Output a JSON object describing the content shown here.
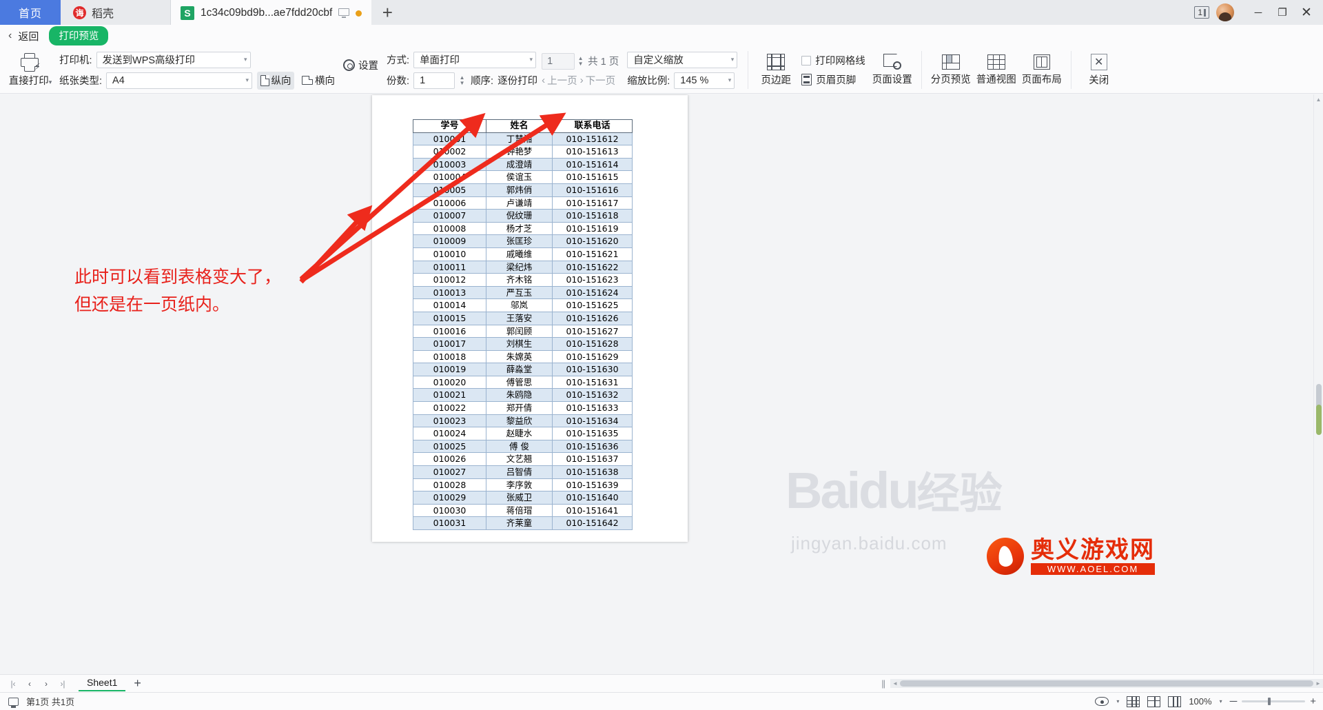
{
  "tabbar": {
    "home_label": "首页",
    "docer_label": "稻壳",
    "doc_label": "1c34c09bd9b...ae7fdd20cbf",
    "plus_label": "+",
    "window_count": "1",
    "minimize": "─",
    "restore": "❐",
    "close": "✕"
  },
  "preview_head": {
    "back_chevron": "‹",
    "back_label": "返回",
    "mode_pill": "打印预览"
  },
  "ribbon": {
    "direct_print_label": "直接打印",
    "direct_print_caret": "▾",
    "printer_label": "打印机:",
    "printer_value": "发送到WPS高级打印",
    "paper_label": "纸张类型:",
    "paper_value": "A4",
    "portrait_label": "纵向",
    "landscape_label": "横向",
    "settings_label": "设置",
    "mode_label": "方式:",
    "mode_value": "单面打印",
    "copies_label": "份数:",
    "copies_value": "1",
    "order_label": "顺序:",
    "order_value": "逐份打印",
    "page_current": "1",
    "page_total": "共 1 页",
    "prev_page": "上一页",
    "next_page": "下一页",
    "prev_chevron": "‹",
    "next_chevron": "›",
    "scale_mode_value": "自定义缩放",
    "scale_ratio_label": "缩放比例:",
    "scale_ratio_value": "145 %",
    "margin_label": "页边距",
    "gridlines_label": "打印网格线",
    "headerfooter_label": "页眉页脚",
    "pagesetup_label": "页面设置",
    "pagebreak_label": "分页预览",
    "normalview_label": "普通视图",
    "pagelayout_label": "页面布局",
    "close_label": "关闭",
    "caret": "▾"
  },
  "annotation": {
    "line1": "此时可以看到表格变大了，",
    "line2": "但还是在一页纸内。",
    "color": "#e8211b"
  },
  "document": {
    "headers": [
      "学号",
      "姓名",
      "联系电话"
    ],
    "rows": [
      [
        "010001",
        "丁慧湘",
        "010-151612"
      ],
      [
        "010002",
        "钟艳梦",
        "010-151613"
      ],
      [
        "010003",
        "成澄靖",
        "010-151614"
      ],
      [
        "010004",
        "侯谊玉",
        "010-151615"
      ],
      [
        "010005",
        "郭炜俏",
        "010-151616"
      ],
      [
        "010006",
        "卢谦靖",
        "010-151617"
      ],
      [
        "010007",
        "倪纹珊",
        "010-151618"
      ],
      [
        "010008",
        "杨才芝",
        "010-151619"
      ],
      [
        "010009",
        "张匡珍",
        "010-151620"
      ],
      [
        "010010",
        "戚曦维",
        "010-151621"
      ],
      [
        "010011",
        "梁纪炜",
        "010-151622"
      ],
      [
        "010012",
        "齐木铭",
        "010-151623"
      ],
      [
        "010013",
        "严互玉",
        "010-151624"
      ],
      [
        "010014",
        "邬岚",
        "010-151625"
      ],
      [
        "010015",
        "王落安",
        "010-151626"
      ],
      [
        "010016",
        "郭闰顾",
        "010-151627"
      ],
      [
        "010017",
        "刘棋生",
        "010-151628"
      ],
      [
        "010018",
        "朱嫦英",
        "010-151629"
      ],
      [
        "010019",
        "薛淼堂",
        "010-151630"
      ],
      [
        "010020",
        "傅管思",
        "010-151631"
      ],
      [
        "010021",
        "朱鸥隐",
        "010-151632"
      ],
      [
        "010022",
        "郑开倩",
        "010-151633"
      ],
      [
        "010023",
        "黎益欣",
        "010-151634"
      ],
      [
        "010024",
        "赵睫水",
        "010-151635"
      ],
      [
        "010025",
        "傅 俊",
        "010-151636"
      ],
      [
        "010026",
        "文艺翘",
        "010-151637"
      ],
      [
        "010027",
        "吕智倩",
        "010-151638"
      ],
      [
        "010028",
        "李序敦",
        "010-151639"
      ],
      [
        "010029",
        "张威卫",
        "010-151640"
      ],
      [
        "010030",
        "蒋倍瑁",
        "010-151641"
      ],
      [
        "010031",
        "齐莱童",
        "010-151642"
      ]
    ]
  },
  "sheetbar": {
    "first": "|‹",
    "prev": "‹",
    "next": "›",
    "last": "›|",
    "sheet_name": "Sheet1",
    "add_sheet": "+",
    "pause_glyph": "||",
    "left_arrow": "◄",
    "right_arrow": "►"
  },
  "statusbar": {
    "page_info": "第1页 共1页",
    "eye_caret": "▾",
    "zoom_level": "100%",
    "minus": "─",
    "plus": "+"
  },
  "watermarks": {
    "baidu_en": "Bai",
    "baidu_du": "du",
    "baidu_cn": "经验",
    "baidu_url": "jingyan.baidu.com",
    "aoel_cn": "奥义游戏网",
    "aoel_url": "WWW.AOEL.COM"
  }
}
